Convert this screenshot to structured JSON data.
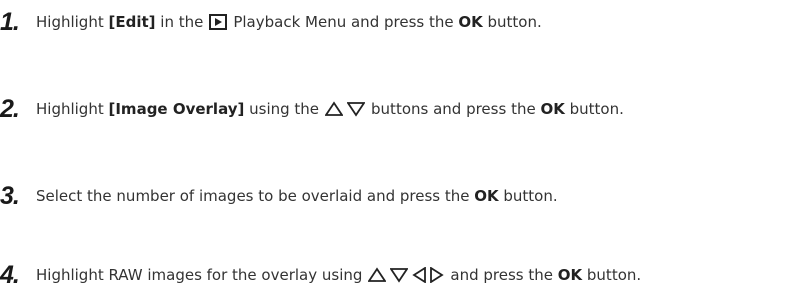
{
  "steps": [
    {
      "number": "1.",
      "parts": [
        "Highlight ",
        "[Edit]",
        " in the",
        "Playback Menu and press the ",
        "OK",
        " button."
      ],
      "icons": [
        "playback-icon"
      ]
    },
    {
      "number": "2.",
      "parts": [
        "Highlight ",
        "[Image Overlay]",
        " using the",
        "buttons and press the ",
        "OK",
        " button."
      ],
      "icons": [
        "triangle-up-icon",
        "triangle-down-icon"
      ]
    },
    {
      "number": "3.",
      "parts": [
        "Select the number of images to be overlaid and press the ",
        "OK",
        " button."
      ],
      "icons": []
    },
    {
      "number": "4.",
      "parts": [
        "Highlight RAW images for the overlay using",
        "and press the ",
        "OK",
        " button."
      ],
      "icons": [
        "triangle-up-icon",
        "triangle-down-icon",
        "triangle-left-icon",
        "triangle-right-icon"
      ]
    }
  ]
}
